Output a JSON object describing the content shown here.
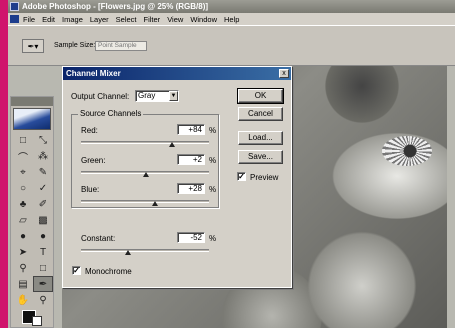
{
  "window": {
    "title": "Adobe Photoshop - [Flowers.jpg @ 25% (RGB/8)]"
  },
  "menu": [
    "File",
    "Edit",
    "Image",
    "Layer",
    "Select",
    "Filter",
    "View",
    "Window",
    "Help"
  ],
  "options_bar": {
    "sample_size_label": "Sample Size:",
    "sample_size_value": "Point Sample"
  },
  "dialog": {
    "title": "Channel Mixer",
    "output_channel_label": "Output Channel:",
    "output_channel_value": "Gray",
    "source_channels_label": "Source Channels",
    "red": {
      "label": "Red:",
      "value": "+84",
      "unit": "%",
      "slider_fraction": 0.71
    },
    "green": {
      "label": "Green:",
      "value": "+2",
      "unit": "%",
      "slider_fraction": 0.51
    },
    "blue": {
      "label": "Blue:",
      "value": "+28",
      "unit": "%",
      "slider_fraction": 0.58
    },
    "constant": {
      "label": "Constant:",
      "value": "-52",
      "unit": "%",
      "slider_fraction": 0.37
    },
    "monochrome_label": "Monochrome",
    "monochrome_checked": true,
    "buttons": {
      "ok": "OK",
      "cancel": "Cancel",
      "load": "Load...",
      "save": "Save..."
    },
    "preview_label": "Preview",
    "preview_checked": true,
    "close_glyph": "x"
  },
  "toolbox": [
    "marquee-icon",
    "move-icon",
    "lasso-icon",
    "magic-wand-icon",
    "crop-icon",
    "slice-icon",
    "healing-icon",
    "brush-icon",
    "clone-stamp-icon",
    "history-brush-icon",
    "eraser-icon",
    "gradient-icon",
    "blur-icon",
    "dodge-icon",
    "path-select-icon",
    "type-icon",
    "pen-icon",
    "shape-icon",
    "notes-icon",
    "eyedropper-icon",
    "hand-icon",
    "zoom-icon"
  ]
}
